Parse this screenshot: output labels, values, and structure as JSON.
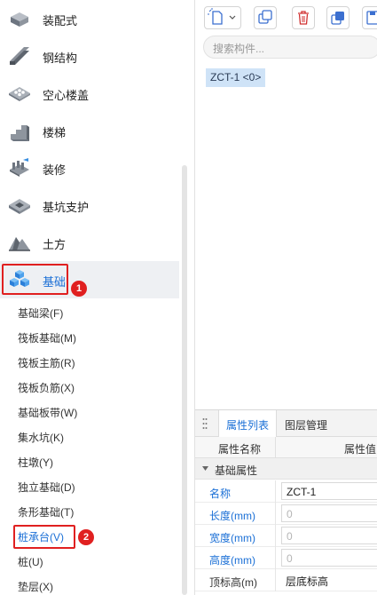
{
  "categories": [
    {
      "label": "装配式",
      "icon": "prefab-icon"
    },
    {
      "label": "钢结构",
      "icon": "steel-beam-icon"
    },
    {
      "label": "空心楼盖",
      "icon": "hollow-slab-icon"
    },
    {
      "label": "楼梯",
      "icon": "stairs-icon"
    },
    {
      "label": "装修",
      "icon": "decoration-icon"
    },
    {
      "label": "基坑支护",
      "icon": "pit-support-icon"
    },
    {
      "label": "土方",
      "icon": "earthwork-icon"
    },
    {
      "label": "基础",
      "icon": "foundation-cubes-icon"
    }
  ],
  "badges": {
    "step1": "1",
    "step2": "2"
  },
  "subitems": [
    "基础梁(F)",
    "筏板基础(M)",
    "筏板主筋(R)",
    "筏板负筋(X)",
    "基础板带(W)",
    "集水坑(K)",
    "柱墩(Y)",
    "独立基础(D)",
    "条形基础(T)",
    "桩承台(V)",
    "桩(U)",
    "垫层(X)"
  ],
  "search": {
    "placeholder": "搜索构件..."
  },
  "component_item": "ZCT-1 <0>",
  "properties": {
    "tabs": [
      "属性列表",
      "图层管理"
    ],
    "headers": {
      "name": "属性名称",
      "value": "属性值"
    },
    "group": "基础属性",
    "rows": [
      {
        "key": "名称",
        "value": "ZCT-1"
      },
      {
        "key": "长度(mm)",
        "value": "0"
      },
      {
        "key": "宽度(mm)",
        "value": "0"
      },
      {
        "key": "高度(mm)",
        "value": "0"
      },
      {
        "key": "顶标高(m)",
        "value": "层底标高"
      }
    ]
  },
  "colors": {
    "accent": "#1a6fd6",
    "highlight": "#e02020",
    "selected_bg": "#cfe3f7"
  }
}
